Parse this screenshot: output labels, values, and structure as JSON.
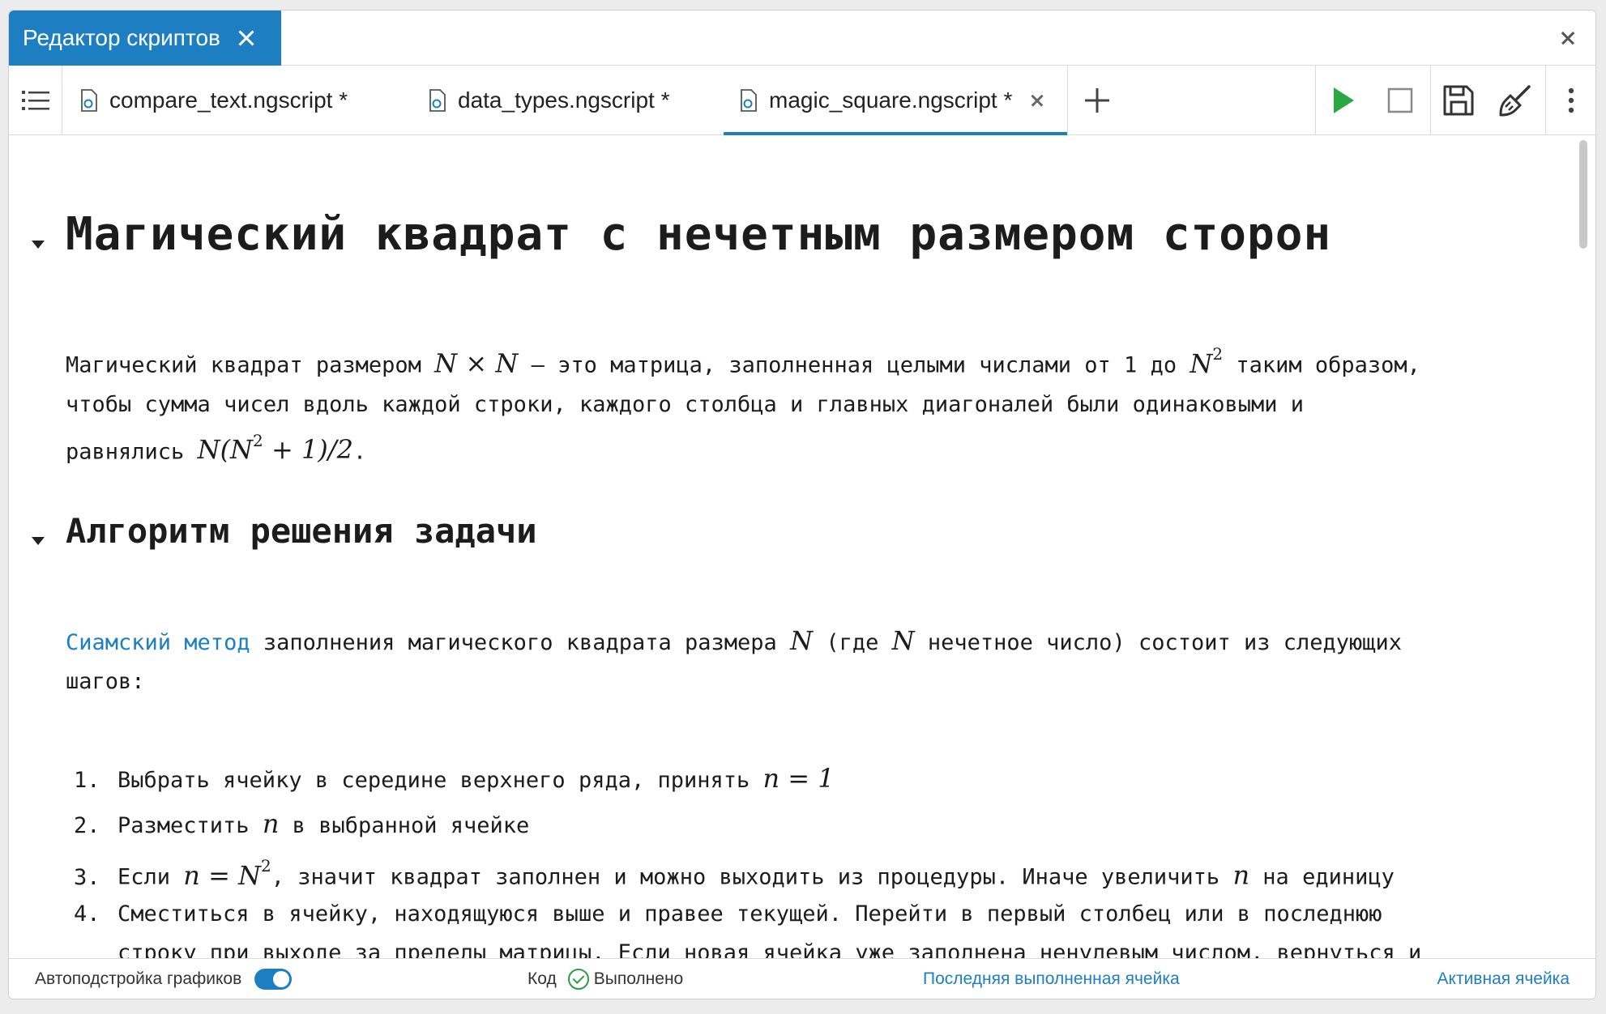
{
  "window": {
    "title_tab": "Редактор скриптов"
  },
  "tabs": [
    {
      "label": "compare_text.ngscript *",
      "active": false
    },
    {
      "label": "data_types.ngscript *",
      "active": false
    },
    {
      "label": "magic_square.ngscript *",
      "active": true
    }
  ],
  "toolbar": {
    "icons": [
      "list-icon",
      "plus-icon",
      "run-icon",
      "stop-icon",
      "save-icon",
      "clean-icon",
      "more-vertical-icon"
    ],
    "colors": {
      "accent": "#1d7fc1",
      "run": "#2aa844"
    }
  },
  "content": {
    "heading1": "Магический квадрат с нечетным размером сторон",
    "para1": {
      "t1": "Магический квадрат размером ",
      "m1": "N × N",
      "t2": " – это матрица, заполненная целыми числами от 1 до ",
      "m2": "N",
      "m2sup": "2",
      "t3": " таким образом,",
      "line2": "чтобы сумма чисел вдоль каждой строки, каждого столбца и главных диагоналей были одинаковыми и",
      "t4": "равнялись ",
      "m3a": "N(N",
      "m3sup": "2",
      "m3b": " + 1)/2",
      "t5": "."
    },
    "heading2": "Алгоритм решения задачи",
    "para2": {
      "link": "Сиамский метод",
      "t1": " заполнения магического квадрата размера ",
      "m1": "N",
      "t2": " (где ",
      "m2": "N",
      "t3": " нечетное число) состоит из следующих",
      "line2": "шагов:"
    },
    "steps": [
      {
        "num": "1.",
        "t1": "Выбрать ячейку в середине верхнего ряда, принять ",
        "m1": "n = 1"
      },
      {
        "num": "2.",
        "t1": "Разместить ",
        "m1": "n",
        "t2": " в выбранной ячейке"
      },
      {
        "num": "3.",
        "t1": "Если ",
        "m1": "n = N",
        "m1sup": "2",
        "t2": ", значит квадрат заполнен и можно выходить из процедуры. Иначе увеличить ",
        "m2": "n",
        "t3": " на единицу"
      },
      {
        "num": "4.",
        "t1": "Сместиться в ячейку, находящуюся выше и правее текущей. Перейти в первый столбец или в последнюю",
        "line2": "строку при выходе за пределы матрицы. Если новая ячейка уже заполнена ненулевым числом, вернуться и"
      }
    ]
  },
  "status": {
    "autoscale_label": "Автоподстройка графиков",
    "autoscale_on": true,
    "code_label": "Код",
    "state_label": "Выполнено",
    "last_cell_link": "Последняя выполненная ячейка",
    "active_cell_link": "Активная ячейка"
  }
}
